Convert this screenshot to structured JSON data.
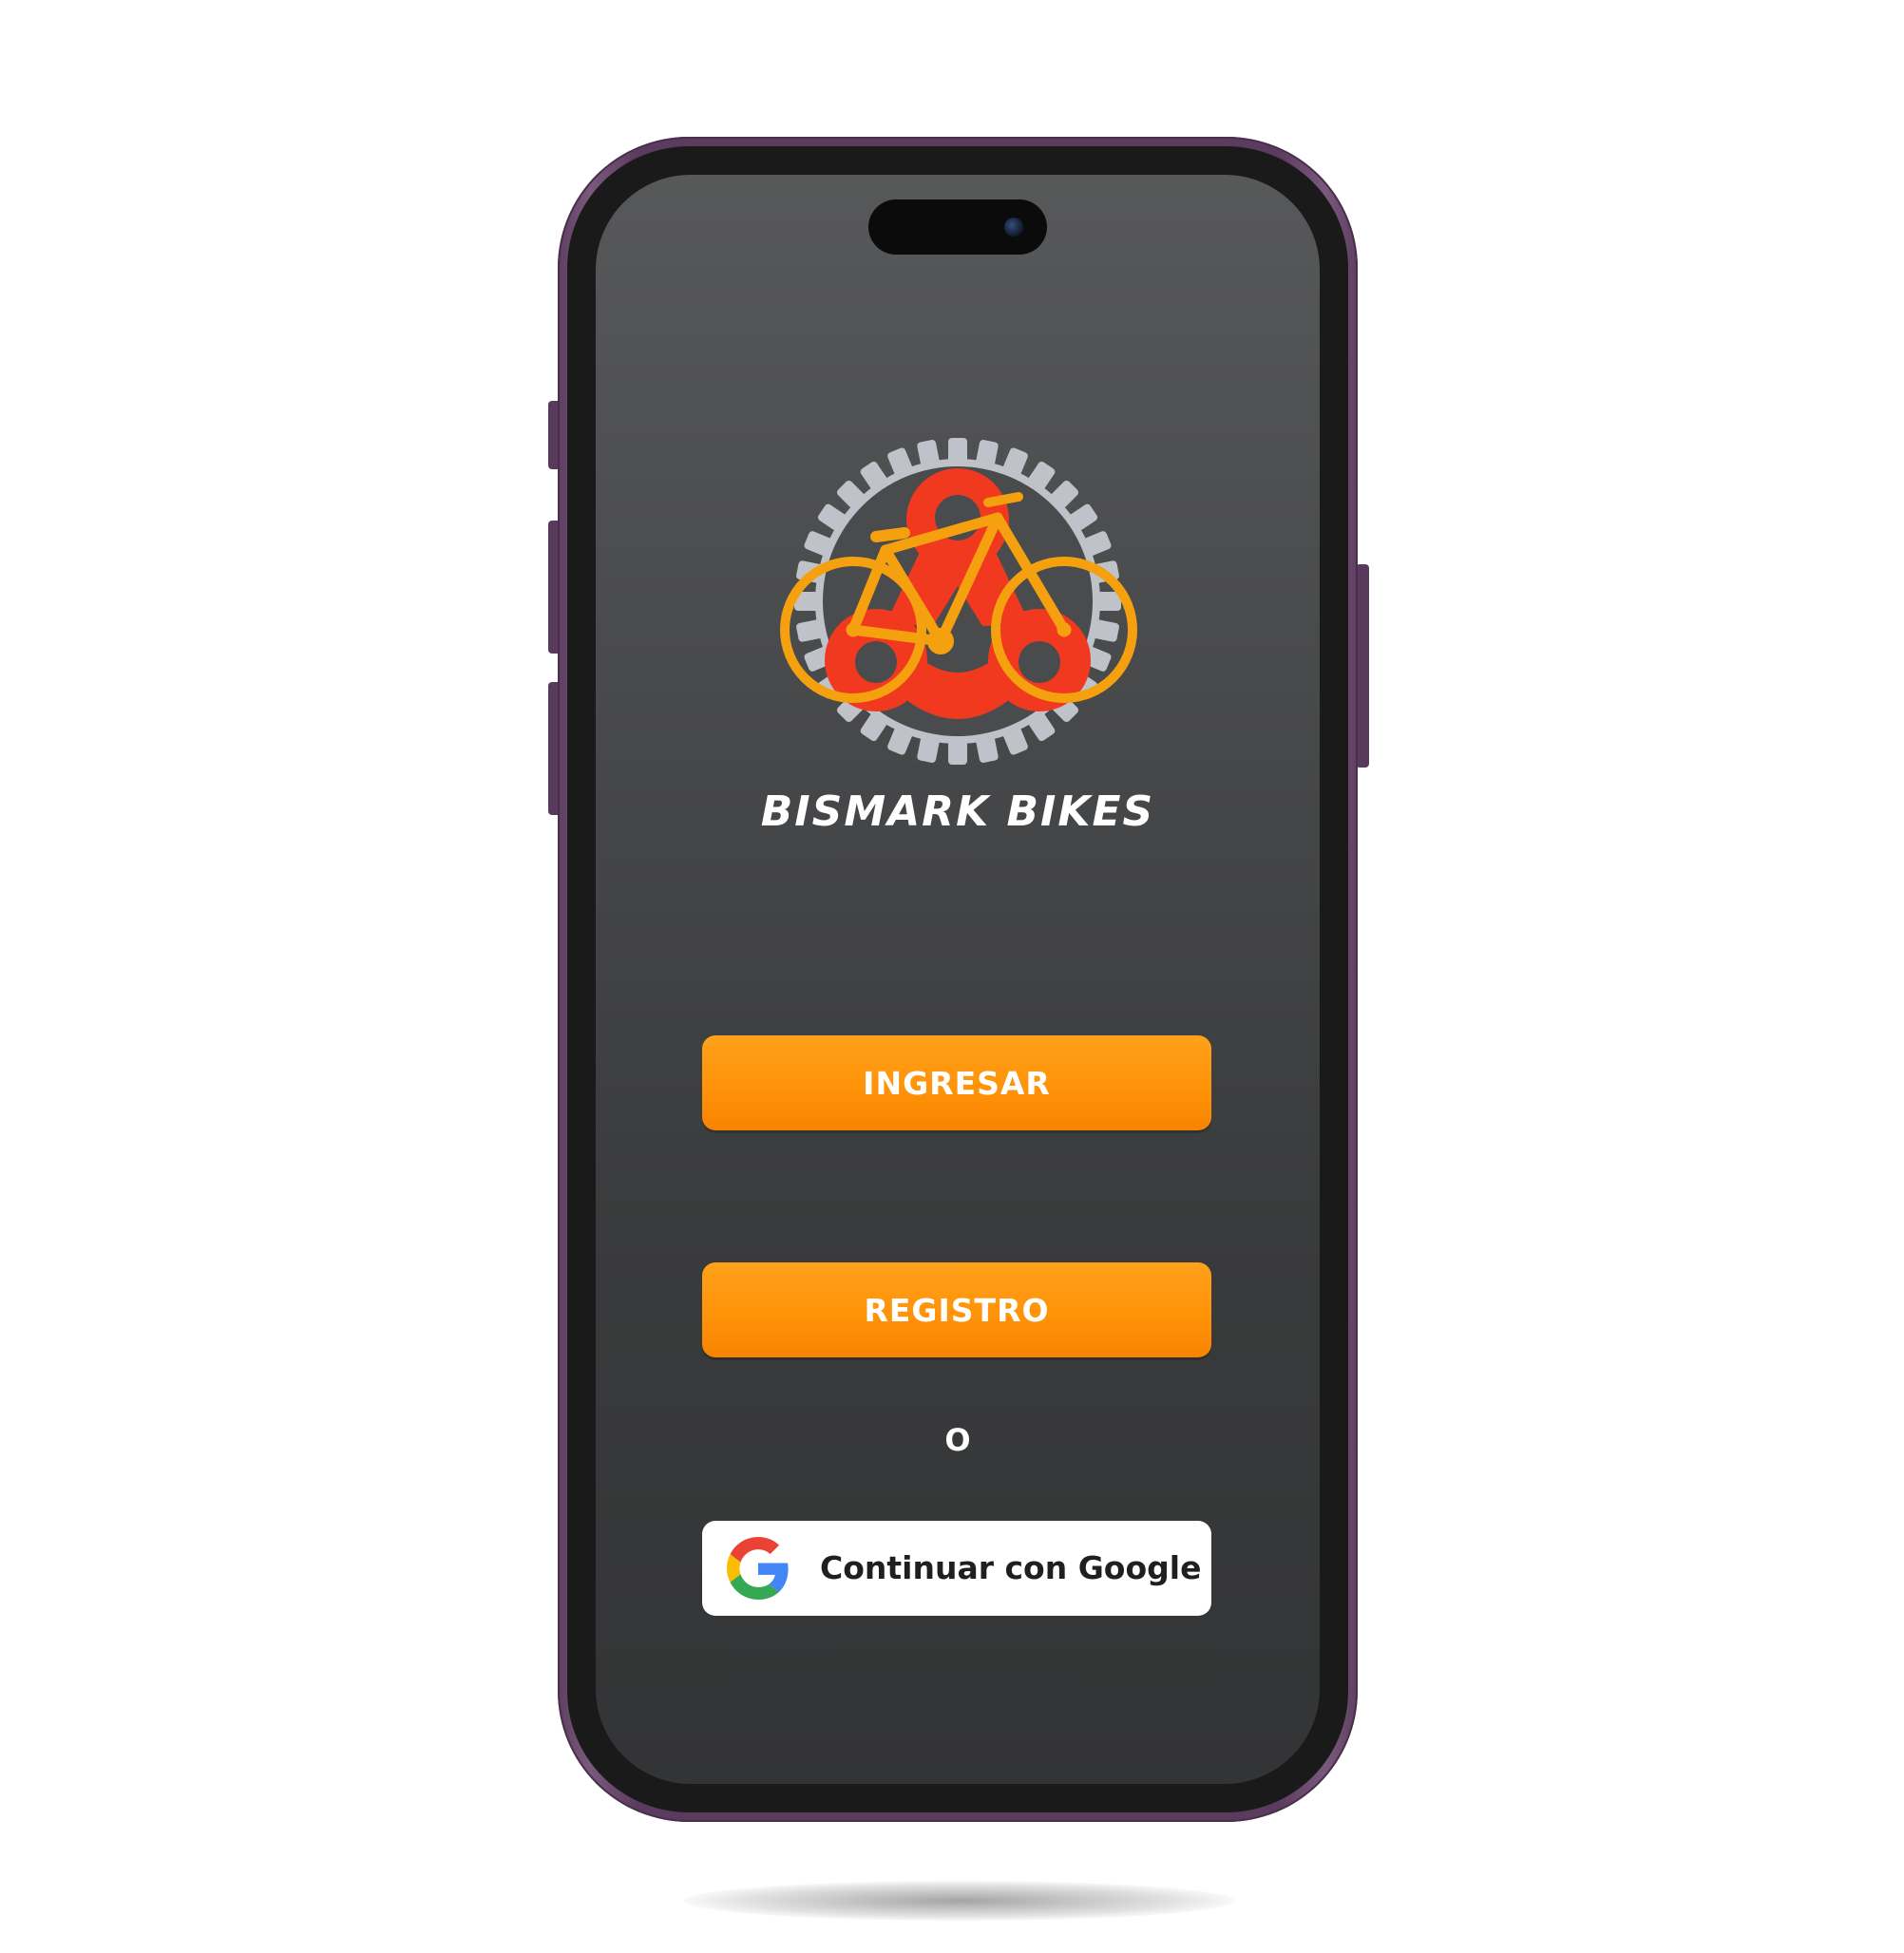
{
  "app": {
    "brand_name": "BISMARK BIKES"
  },
  "actions": {
    "login_label": "INGRESAR",
    "register_label": "REGISTRO",
    "separator_text": "O",
    "google_label": "Continuar con Google"
  },
  "colors": {
    "accent_orange": "#FF9309",
    "chain_red": "#F0391E",
    "bike_yellow": "#F5A10F",
    "gear_gray": "#BFC3C9",
    "screen_background": "#3F4041",
    "phone_frame": "#5B3C5E"
  },
  "icons": {
    "logo": "gear-chain-bicycle-logo",
    "google": "google-g-icon",
    "camera": "front-camera-icon"
  }
}
